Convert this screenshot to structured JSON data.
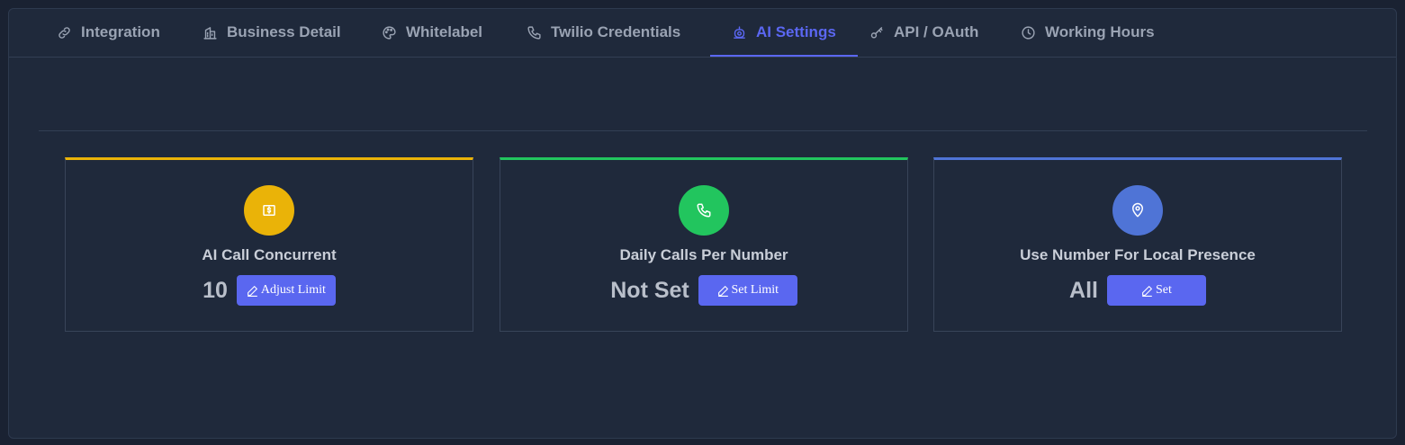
{
  "tabs": [
    {
      "label": "Integration",
      "icon": "link-icon"
    },
    {
      "label": "Business Detail",
      "icon": "building-icon"
    },
    {
      "label": "Whitelabel",
      "icon": "palette-icon"
    },
    {
      "label": "Twilio Credentials",
      "icon": "phone-icon"
    },
    {
      "label": "AI Settings",
      "icon": "robot-icon",
      "active": true
    },
    {
      "label": "API / OAuth",
      "icon": "key-icon"
    },
    {
      "label": "Working Hours",
      "icon": "clock-icon"
    }
  ],
  "accent_color": "#5b67f2",
  "cards": [
    {
      "title": "AI Call Concurrent",
      "value": "10",
      "button_label": "Adjust Limit",
      "icon": "money-icon",
      "color": "#eab308"
    },
    {
      "title": "Daily Calls Per Number",
      "value": "Not Set",
      "button_label": "Set Limit",
      "icon": "phone-icon",
      "color": "#22c55e"
    },
    {
      "title": "Use Number For Local Presence",
      "value": "All",
      "button_label": "Set",
      "icon": "location-pin-icon",
      "color": "#4f74d6"
    }
  ]
}
